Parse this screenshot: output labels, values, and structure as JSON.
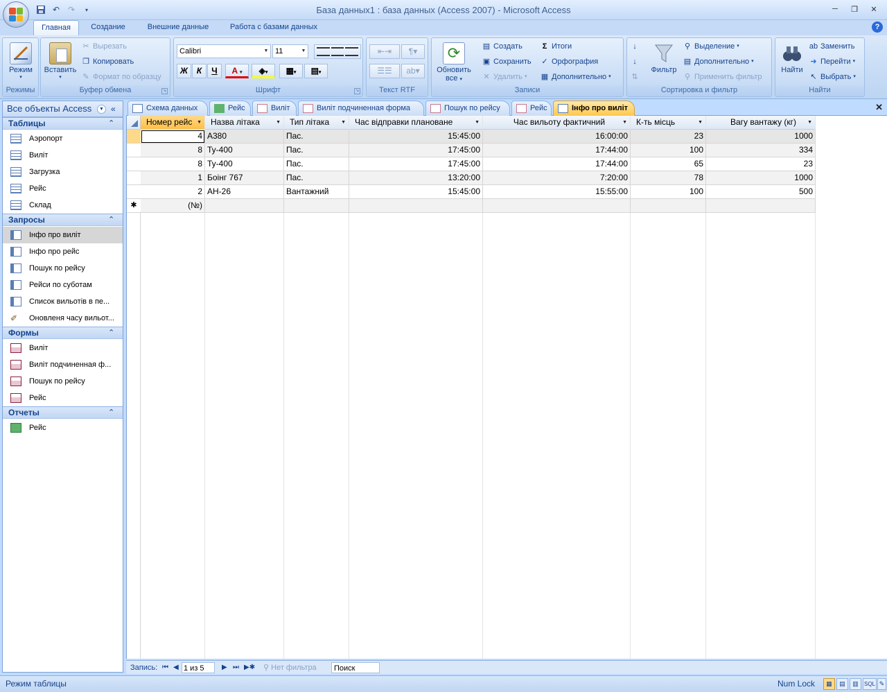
{
  "window": {
    "title": "База данных1 : база данных (Access 2007) - Microsoft Access",
    "controls": [
      "minimize-icon",
      "restore-icon",
      "close-icon"
    ]
  },
  "ribbon_tabs": [
    "Главная",
    "Создание",
    "Внешние данные",
    "Работа с базами данных"
  ],
  "ribbon": {
    "modes": {
      "label": "Режимы",
      "view_btn": "Режим"
    },
    "clipboard": {
      "label": "Буфер обмена",
      "paste": "Вставить",
      "cut": "Вырезать",
      "copy": "Копировать",
      "format_painter": "Формат по образцу"
    },
    "font": {
      "label": "Шрифт",
      "font_name": "Calibri",
      "font_size": "11",
      "bold": "Ж",
      "italic": "К",
      "underline": "Ч",
      "font_color_glyph": "A"
    },
    "rtf": {
      "label": "Текст RTF"
    },
    "records": {
      "label": "Записи",
      "refresh_line1": "Обновить",
      "refresh_line2": "все",
      "new": "Создать",
      "save": "Сохранить",
      "delete": "Удалить",
      "totals": "Итоги",
      "spelling": "Орфография",
      "more": "Дополнительно"
    },
    "sort": {
      "label": "Сортировка и фильтр",
      "filter": "Фильтр",
      "selection": "Выделение",
      "advanced": "Дополнительно",
      "apply_filter": "Применить фильтр"
    },
    "find": {
      "label": "Найти",
      "find_btn": "Найти",
      "replace": "Заменить",
      "goto": "Перейти",
      "select": "Выбрать"
    }
  },
  "nav_pane": {
    "header": "Все объекты Access",
    "sections": [
      {
        "title": "Таблицы",
        "items": [
          "Аэропорт",
          "Виліт",
          "Загрузка",
          "Рейс",
          "Склад"
        ]
      },
      {
        "title": "Запросы",
        "items": [
          "Інфо про виліт",
          "Інфо про рейс",
          "Пошук по рейсу",
          "Рейси по суботам",
          "Список вильотів в пе...",
          "Оновленя часу вильот..."
        ]
      },
      {
        "title": "Формы",
        "items": [
          "Виліт",
          "Виліт подчиненная ф...",
          "Пошук по рейсу",
          "Рейс"
        ]
      },
      {
        "title": "Отчеты",
        "items": [
          "Рейс"
        ]
      }
    ]
  },
  "doc_tabs": [
    "Схема данных",
    "Рейс",
    "Виліт",
    "Виліт подчиненная форма",
    "Пошук по рейсу",
    "Рейс",
    "Інфо про виліт"
  ],
  "datasheet": {
    "columns": [
      "Номер рейс",
      "Назва літака",
      "Тип літака",
      "Час відправки плановане",
      "Час вильоту фактичний",
      "К-ть місць",
      "Вагу вантажу (кг)"
    ],
    "rows": [
      [
        "4",
        "А380",
        "Пас.",
        "15:45:00",
        "16:00:00",
        "23",
        "1000"
      ],
      [
        "8",
        "Ту-400",
        "Пас.",
        "17:45:00",
        "17:44:00",
        "100",
        "334"
      ],
      [
        "8",
        "Ту-400",
        "Пас.",
        "17:45:00",
        "17:44:00",
        "65",
        "23"
      ],
      [
        "1",
        " Боінг 767",
        "Пас.",
        "13:20:00",
        "7:20:00",
        "78",
        "1000"
      ],
      [
        "2",
        "АН-26",
        "Вантажний",
        "15:45:00",
        "15:55:00",
        "100",
        "500"
      ]
    ],
    "new_row_marker": "✱",
    "new_row_placeholder": "(№)"
  },
  "record_nav": {
    "label": "Запись:",
    "position": "1 из 5",
    "no_filter": "Нет фильтра",
    "search": "Поиск"
  },
  "status": {
    "mode": "Режим таблицы",
    "numlock": "Num Lock",
    "sql": "SQL"
  }
}
